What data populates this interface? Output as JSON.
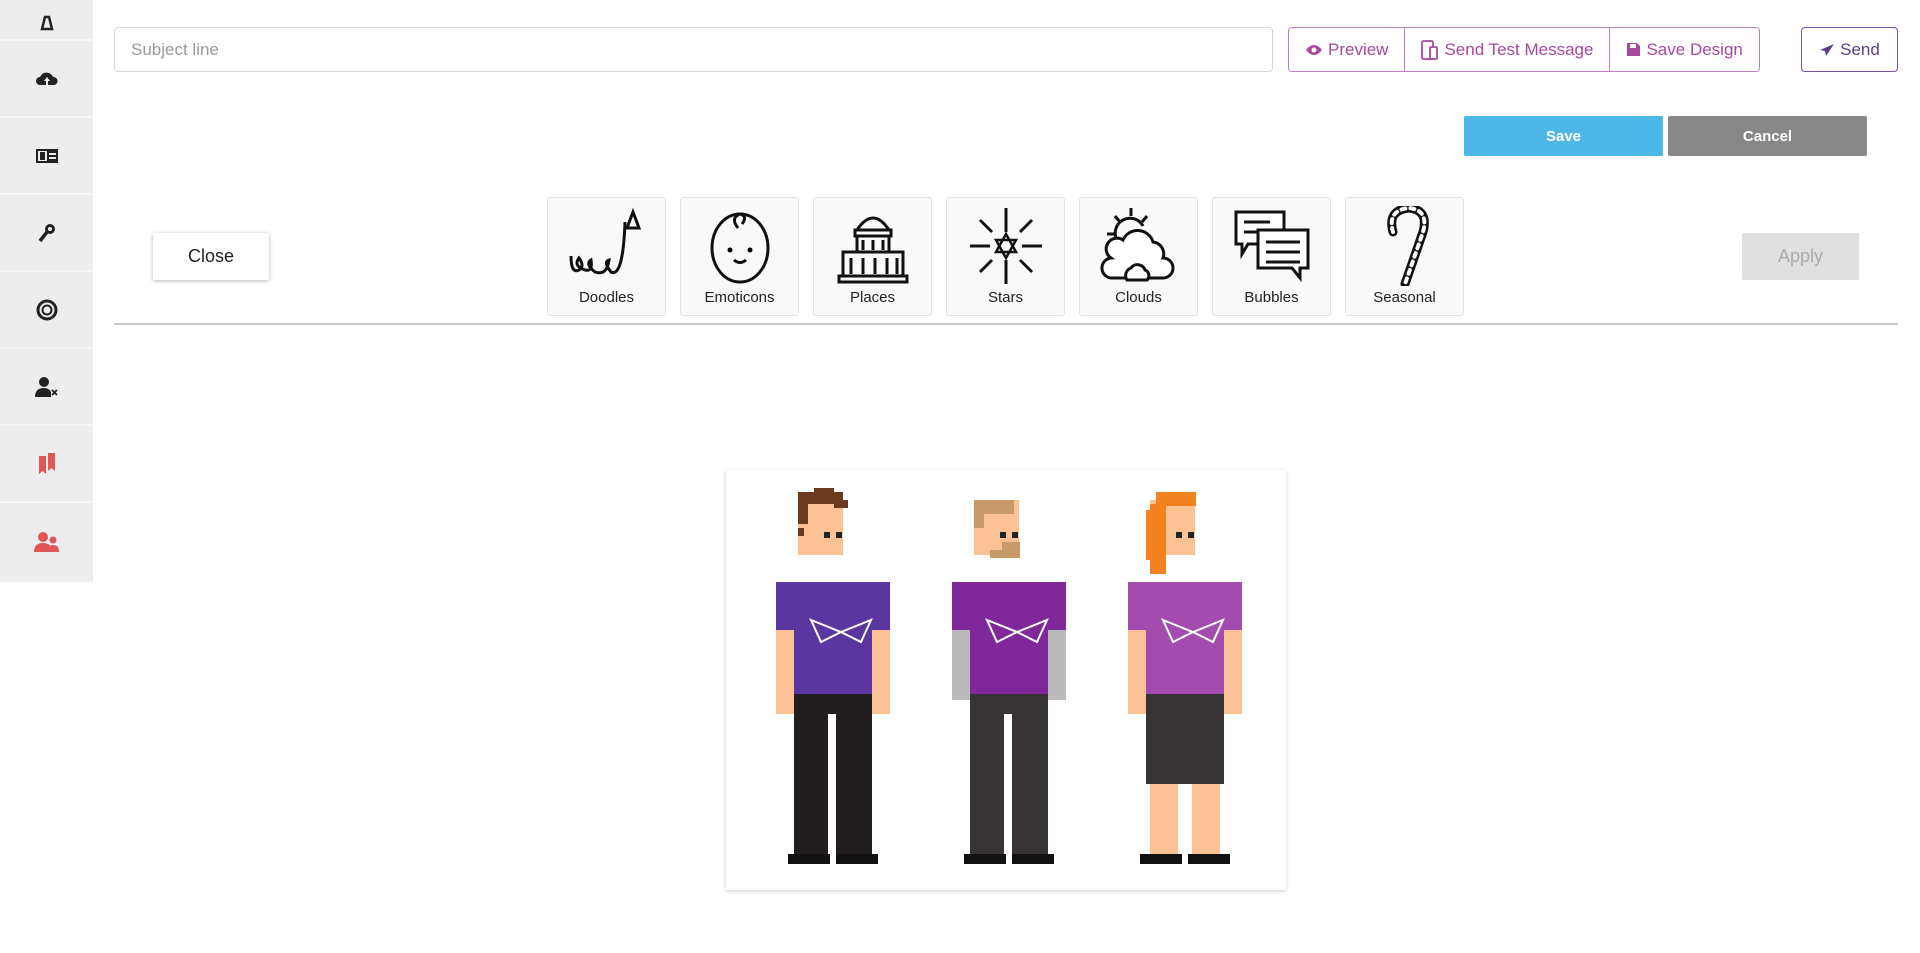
{
  "sidebar": {
    "items": [
      {
        "icon": "user-bell-icon",
        "color": "#222222"
      },
      {
        "icon": "cloud-upload-icon",
        "color": "#222222"
      },
      {
        "icon": "id-card-icon",
        "color": "#222222"
      },
      {
        "icon": "key-icon",
        "color": "#222222"
      },
      {
        "icon": "life-ring-icon",
        "color": "#222222"
      },
      {
        "icon": "user-remove-icon",
        "color": "#222222"
      },
      {
        "icon": "bookmarks-icon",
        "color": "#e05555"
      },
      {
        "icon": "users-icon",
        "color": "#e05555"
      }
    ]
  },
  "header": {
    "subject_placeholder": "Subject line",
    "subject_value": "",
    "preview_label": "Preview",
    "send_test_label": "Send Test Message",
    "save_design_label": "Save Design",
    "send_label": "Send"
  },
  "editor": {
    "save_label": "Save",
    "cancel_label": "Cancel",
    "accent": "#4db8e8"
  },
  "sticker_panel": {
    "close_label": "Close",
    "apply_label": "Apply",
    "categories": [
      "Doodles",
      "Emoticons",
      "Places",
      "Stars",
      "Clouds",
      "Bubbles",
      "Seasonal"
    ]
  },
  "colors": {
    "brand": "#a9489f",
    "send": "#5b3d8a"
  }
}
